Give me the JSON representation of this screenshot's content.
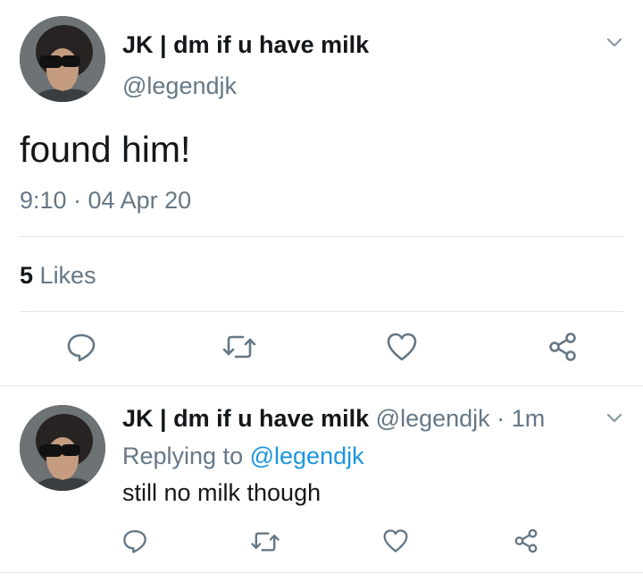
{
  "main_tweet": {
    "display_name": "JK | dm if u have milk",
    "handle": "@legendjk",
    "text": "found him!",
    "timestamp": "9:10 · 04 Apr 20",
    "likes_count": "5",
    "likes_label": "Likes"
  },
  "reply_tweet": {
    "display_name": "JK | dm if u have milk",
    "handle": "@legendjk",
    "separator": "·",
    "age": "1m",
    "replying_label": "Replying to",
    "replying_handle": "@legendjk",
    "text": "still no milk though"
  },
  "icons": {
    "reply": "speech-bubble-icon",
    "retweet": "retweet-icon",
    "like": "heart-icon",
    "share": "share-icon",
    "menu": "chevron-down-icon"
  },
  "colors": {
    "text": "#14171a",
    "muted": "#657786",
    "link": "#1b95e0",
    "divider": "#e1e8ed"
  }
}
